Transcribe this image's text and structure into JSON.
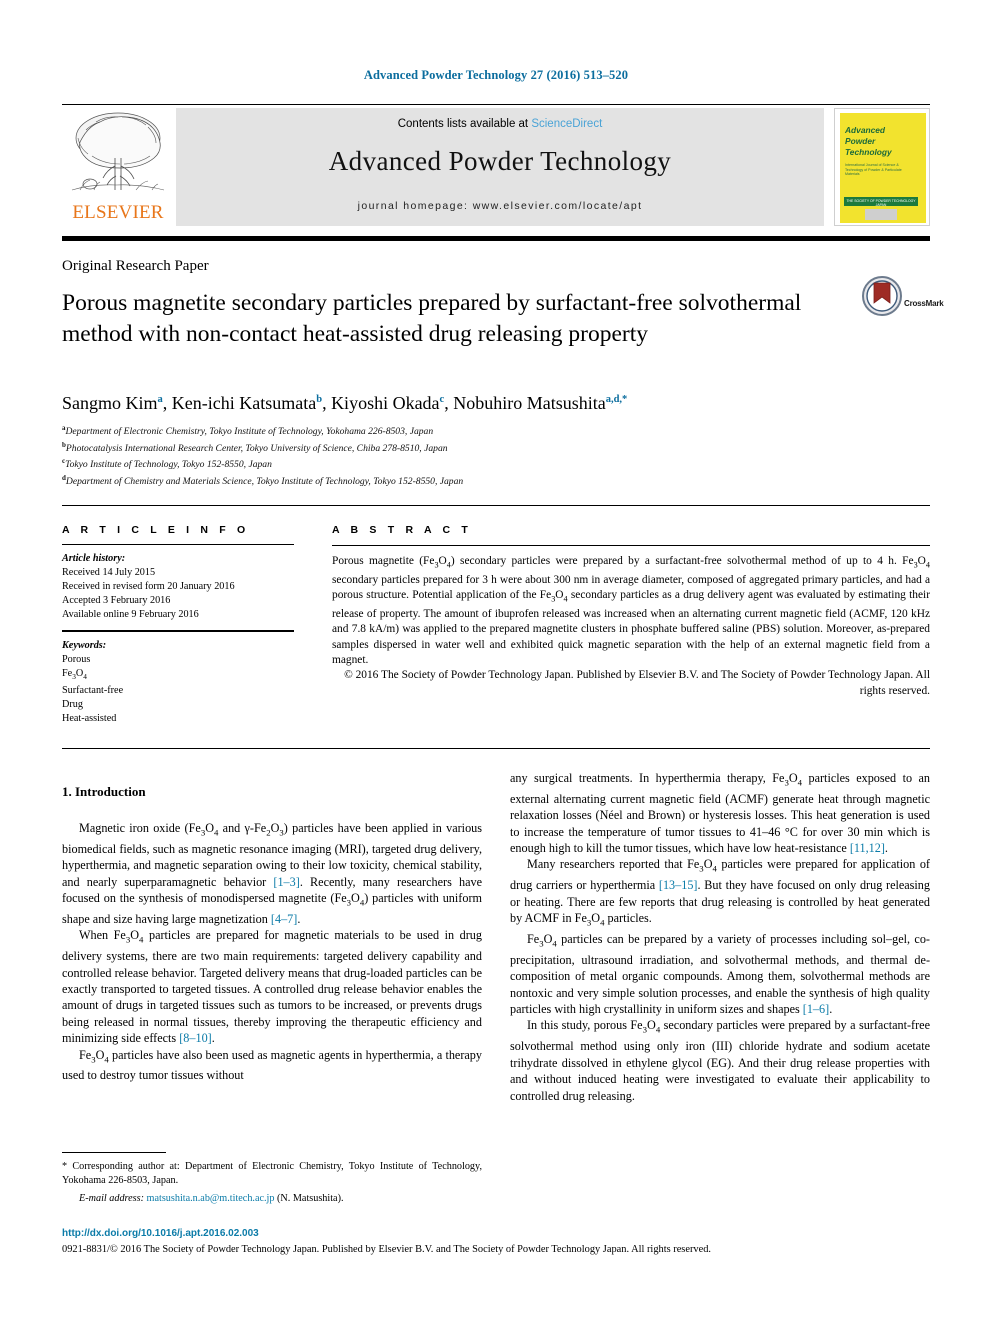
{
  "running_head": "Advanced Powder Technology 27 (2016) 513–520",
  "masthead": {
    "contents_prefix": "Contents lists available at ",
    "sciencedirect": "ScienceDirect",
    "journal_title": "Advanced Powder Technology",
    "homepage": "journal homepage: www.elsevier.com/locate/apt",
    "publisher_wordmark": "ELSEVIER",
    "cover": {
      "line1": "Advanced",
      "line2": "Powder",
      "line3": "Technology",
      "subtitle": "International Journal of Science & Technology of Powder & Particulate Materials",
      "bar_text": "THE SOCIETY OF POWDER TECHNOLOGY JAPAN"
    },
    "accent_color": "#4aa3d6",
    "elsevier_orange": "#E8761A"
  },
  "article": {
    "type": "Original Research Paper",
    "title": "Porous magnetite secondary particles prepared by surfactant-free solvothermal method with non-contact heat-assisted drug releasing property",
    "crossmark_label": "CrossMark"
  },
  "authors": {
    "list": [
      {
        "name": "Sangmo Kim",
        "marks": "a"
      },
      {
        "name": "Ken-ichi Katsumata",
        "marks": "b"
      },
      {
        "name": "Kiyoshi Okada",
        "marks": "c"
      },
      {
        "name": "Nobuhiro Matsushita",
        "marks": "a,d,*"
      }
    ],
    "affiliations": [
      {
        "mark": "a",
        "text": "Department of Electronic Chemistry, Tokyo Institute of Technology, Yokohama 226-8503, Japan"
      },
      {
        "mark": "b",
        "text": "Photocatalysis International Research Center, Tokyo University of Science, Chiba 278-8510, Japan"
      },
      {
        "mark": "c",
        "text": "Tokyo Institute of Technology, Tokyo 152-8550, Japan"
      },
      {
        "mark": "d",
        "text": "Department of Chemistry and Materials Science, Tokyo Institute of Technology, Tokyo 152-8550, Japan"
      }
    ]
  },
  "article_info": {
    "heading": "A R T I C L E    I N F O",
    "history_label": "Article history:",
    "history": [
      "Received 14 July 2015",
      "Received in revised form 20 January 2016",
      "Accepted 3 February 2016",
      "Available online 9 February 2016"
    ],
    "keywords_label": "Keywords:",
    "keywords": [
      "Porous",
      "Fe3O4",
      "Surfactant-free",
      "Drug",
      "Heat-assisted"
    ]
  },
  "abstract": {
    "heading": "A B S T R A C T",
    "body": "Porous magnetite (Fe3O4) secondary particles were prepared by a surfactant-free solvothermal method of up to 4 h. Fe3O4 secondary particles prepared for 3 h were about 300 nm in average diameter, composed of aggregated primary particles, and had a porous structure. Potential application of the Fe3O4 secondary particles as a drug delivery agent was evaluated by estimating their release of property. The amount of ibuprofen released was increased when an alternating current magnetic field (ACMF, 120 kHz and 7.8 kA/m) was applied to the prepared magnetite clusters in phosphate buffered saline (PBS) solution. Moreover, as-prepared samples dispersed in water well and exhibited quick magnetic separation with the help of an external magnetic field from a magnet.",
    "copyright": "© 2016 The Society of Powder Technology Japan. Published by Elsevier B.V. and The Society of Powder Technology Japan. All rights reserved."
  },
  "introduction": {
    "section_title": "1. Introduction",
    "left_paragraphs": [
      "Magnetic iron oxide (Fe3O4 and γ-Fe2O3) particles have been applied in various biomedical fields, such as magnetic resonance imaging (MRI), targeted drug delivery, hyperthermia, and magnetic separation owing to their low toxicity, chemical stability, and nearly superparamagnetic behavior [1–3]. Recently, many researchers have focused on the synthesis of monodispersed magnetite (Fe3O4) particles with uniform shape and size having large magnetization [4–7].",
      "When Fe3O4 particles are prepared for magnetic materials to be used in drug delivery systems, there are two main requirements: targeted delivery capability and controlled release behavior. Targeted delivery means that drug-loaded particles can be exactly transported to targeted tissues. A controlled drug release behavior enables the amount of drugs in targeted tissues such as tumors to be increased, or prevents drugs being released in normal tissues, thereby improving the therapeutic efficiency and minimizing side effects [8–10].",
      "Fe3O4 particles have also been used as magnetic agents in hyperthermia, a therapy used to destroy tumor tissues without"
    ],
    "right_paragraphs": [
      "any surgical treatments. In hyperthermia therapy, Fe3O4 particles exposed to an external alternating current magnetic field (ACMF) generate heat through magnetic relaxation losses (Néel and Brown) or hysteresis losses. This heat generation is used to increase the temperature of tumor tissues to 41–46 °C for over 30 min which is enough high to kill the tumor tissues, which have low heat-resistance [11,12].",
      "Many researchers reported that Fe3O4 particles were prepared for application of drug carriers or hyperthermia [13–15]. But they have focused on only drug releasing or heating. There are few reports that drug releasing is controlled by heat generated by ACMF in Fe3O4 particles.",
      "Fe3O4 particles can be prepared by a variety of processes including sol–gel, co-precipitation, ultrasound irradiation, and solvothermal methods, and thermal de-composition of metal organic compounds. Among them, solvothermal methods are nontoxic and very simple solution processes, and enable the synthesis of high quality particles with high crystallinity in uniform sizes and shapes [1–6].",
      "In this study, porous Fe3O4 secondary particles were prepared by a surfactant-free solvothermal method using only iron (III) chloride hydrate and sodium acetate trihydrate dissolved in ethylene glycol (EG). And their drug release properties with and without induced heating were investigated to evaluate their applicability to controlled drug releasing."
    ]
  },
  "footnote": {
    "corresponding": "* Corresponding author at: Department of Electronic Chemistry, Tokyo Institute of Technology, Yokohama 226-8503, Japan.",
    "email_label": "E-mail address:",
    "email": "matsushita.n.ab@m.titech.ac.jp",
    "email_suffix": "(N. Matsushita)."
  },
  "footer": {
    "doi": "http://dx.doi.org/10.1016/j.apt.2016.02.003",
    "copyright": "0921-8831/© 2016 The Society of Powder Technology Japan. Published by Elsevier B.V. and The Society of Powder Technology Japan. All rights reserved."
  }
}
